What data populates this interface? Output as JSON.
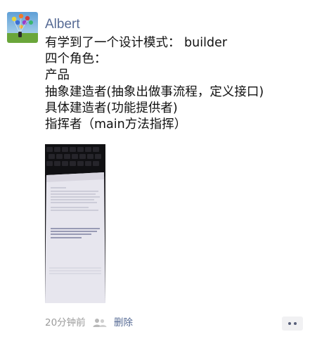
{
  "post": {
    "author": "Albert",
    "text_lines": [
      "有学到了一个设计模式： builder",
      "四个角色：",
      "产品",
      "抽象建造者(抽象出做事流程，定义接口)",
      "具体建造者(功能提供者)",
      "指挥者（main方法指挥）"
    ],
    "photo_icon": "photo-of-printed-document",
    "time": "20分钟前",
    "visibility_icon": "friends-icon",
    "delete_label": "删除",
    "more_icon": "more-dots-icon"
  },
  "colors": {
    "link": "#576b95",
    "meta": "#9b9b9b",
    "text": "#111111"
  }
}
